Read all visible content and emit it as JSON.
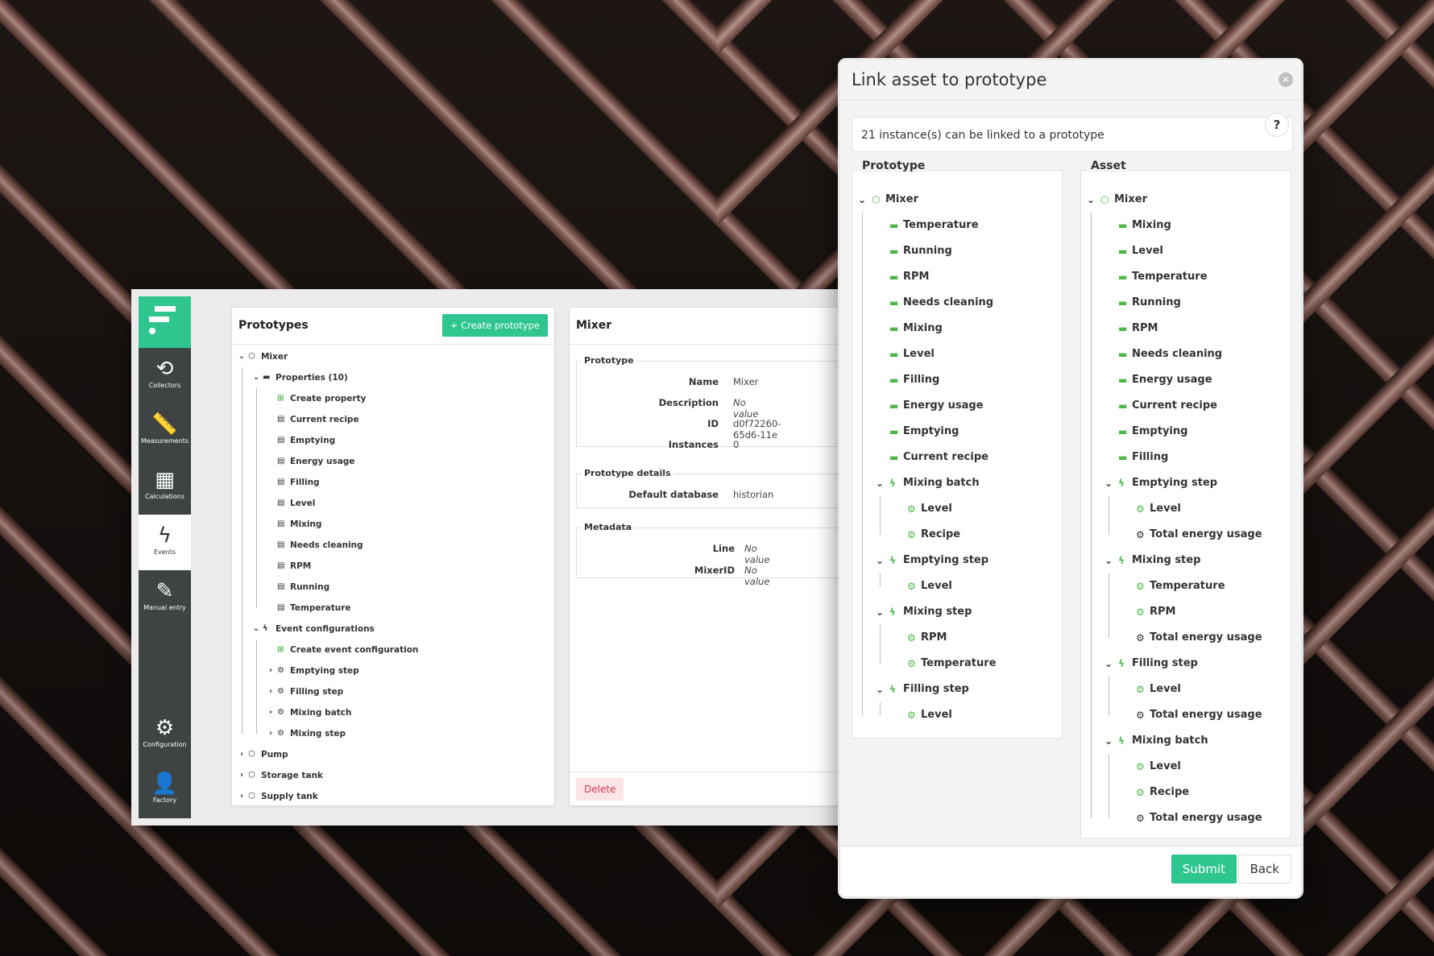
{
  "sidebar": {
    "items": [
      {
        "label": "Collectors",
        "icon": "history-icon"
      },
      {
        "label": "Measurements",
        "icon": "ruler-icon"
      },
      {
        "label": "Calculations",
        "icon": "calculator-icon"
      },
      {
        "label": "Events",
        "icon": "bolt-icon"
      },
      {
        "label": "Manual entry",
        "icon": "pencil-icon"
      }
    ],
    "bottom_items": [
      {
        "label": "Configuration",
        "icon": "gears-icon"
      },
      {
        "label": "Factory",
        "icon": "user-gear-icon"
      }
    ]
  },
  "prototypes": {
    "title": "Prototypes",
    "create_label": "Create prototype",
    "tree": [
      {
        "label": "Mixer",
        "lvl": 0,
        "caret": "down",
        "icon": "cube"
      },
      {
        "label": "Properties (10)",
        "lvl": 1,
        "caret": "down",
        "icon": "ruler"
      },
      {
        "label": "Create property",
        "lvl": 2,
        "icon": "plus"
      },
      {
        "label": "Current recipe",
        "lvl": 2,
        "icon": "table"
      },
      {
        "label": "Emptying",
        "lvl": 2,
        "icon": "table"
      },
      {
        "label": "Energy usage",
        "lvl": 2,
        "icon": "table"
      },
      {
        "label": "Filling",
        "lvl": 2,
        "icon": "table"
      },
      {
        "label": "Level",
        "lvl": 2,
        "icon": "table"
      },
      {
        "label": "Mixing",
        "lvl": 2,
        "icon": "table"
      },
      {
        "label": "Needs cleaning",
        "lvl": 2,
        "icon": "table"
      },
      {
        "label": "RPM",
        "lvl": 2,
        "icon": "table"
      },
      {
        "label": "Running",
        "lvl": 2,
        "icon": "table"
      },
      {
        "label": "Temperature",
        "lvl": 2,
        "icon": "table"
      },
      {
        "label": "Event configurations",
        "lvl": 1,
        "caret": "down",
        "icon": "bolt"
      },
      {
        "label": "Create event configuration",
        "lvl": 2,
        "icon": "plus"
      },
      {
        "label": "Emptying step",
        "lvl": 2,
        "caret": "right",
        "icon": "gears"
      },
      {
        "label": "Filling step",
        "lvl": 2,
        "caret": "right",
        "icon": "gears"
      },
      {
        "label": "Mixing batch",
        "lvl": 2,
        "caret": "right",
        "icon": "gears"
      },
      {
        "label": "Mixing step",
        "lvl": 2,
        "caret": "right",
        "icon": "gears"
      },
      {
        "label": "Pump",
        "lvl": 0,
        "caret": "right",
        "icon": "cube"
      },
      {
        "label": "Storage tank",
        "lvl": 0,
        "caret": "right",
        "icon": "cube"
      },
      {
        "label": "Supply tank",
        "lvl": 0,
        "caret": "right",
        "icon": "cube"
      }
    ]
  },
  "detail": {
    "title": "Mixer",
    "prototype_legend": "Prototype",
    "name_label": "Name",
    "name_value": "Mixer",
    "description_label": "Description",
    "description_value": "No value",
    "id_label": "ID",
    "id_value": "d0f72260-65d6-11e",
    "instances_label": "Instances",
    "instances_value": "0",
    "details_legend": "Prototype details",
    "default_db_label": "Default database",
    "default_db_value": "historian",
    "metadata_legend": "Metadata",
    "line_label": "Line",
    "line_value": "No value",
    "mixerid_label": "MixerID",
    "mixerid_value": "No value",
    "delete_label": "Delete"
  },
  "modal": {
    "title": "Link asset to prototype",
    "close_icon": "close-icon",
    "info": "21 instance(s) can be linked to a prototype",
    "help": "?",
    "prototype_title": "Prototype",
    "asset_title": "Asset",
    "prototype_tree": [
      {
        "label": "Mixer",
        "lvl": 0,
        "caret": "down",
        "icon": "cube"
      },
      {
        "label": "Temperature",
        "lvl": 1,
        "icon": "ruler"
      },
      {
        "label": "Running",
        "lvl": 1,
        "icon": "ruler"
      },
      {
        "label": "RPM",
        "lvl": 1,
        "icon": "ruler"
      },
      {
        "label": "Needs cleaning",
        "lvl": 1,
        "icon": "ruler"
      },
      {
        "label": "Mixing",
        "lvl": 1,
        "icon": "ruler"
      },
      {
        "label": "Level",
        "lvl": 1,
        "icon": "ruler"
      },
      {
        "label": "Filling",
        "lvl": 1,
        "icon": "ruler"
      },
      {
        "label": "Energy usage",
        "lvl": 1,
        "icon": "ruler"
      },
      {
        "label": "Emptying",
        "lvl": 1,
        "icon": "ruler"
      },
      {
        "label": "Current recipe",
        "lvl": 1,
        "icon": "ruler"
      },
      {
        "label": "Mixing batch",
        "lvl": 1,
        "caret": "down",
        "icon": "bolt"
      },
      {
        "label": "Level",
        "lvl": 2,
        "icon": "gears-g"
      },
      {
        "label": "Recipe",
        "lvl": 2,
        "icon": "gears-g"
      },
      {
        "label": "Emptying step",
        "lvl": 1,
        "caret": "down",
        "icon": "bolt"
      },
      {
        "label": "Level",
        "lvl": 2,
        "icon": "gears-g"
      },
      {
        "label": "Mixing step",
        "lvl": 1,
        "caret": "down",
        "icon": "bolt"
      },
      {
        "label": "RPM",
        "lvl": 2,
        "icon": "gears-g"
      },
      {
        "label": "Temperature",
        "lvl": 2,
        "icon": "gears-g"
      },
      {
        "label": "Filling step",
        "lvl": 1,
        "caret": "down",
        "icon": "bolt"
      },
      {
        "label": "Level",
        "lvl": 2,
        "icon": "gears-g"
      }
    ],
    "asset_tree": [
      {
        "label": "Mixer",
        "lvl": 0,
        "caret": "down",
        "icon": "cube"
      },
      {
        "label": "Mixing",
        "lvl": 1,
        "icon": "ruler"
      },
      {
        "label": "Level",
        "lvl": 1,
        "icon": "ruler"
      },
      {
        "label": "Temperature",
        "lvl": 1,
        "icon": "ruler"
      },
      {
        "label": "Running",
        "lvl": 1,
        "icon": "ruler"
      },
      {
        "label": "RPM",
        "lvl": 1,
        "icon": "ruler"
      },
      {
        "label": "Needs cleaning",
        "lvl": 1,
        "icon": "ruler"
      },
      {
        "label": "Energy usage",
        "lvl": 1,
        "icon": "ruler"
      },
      {
        "label": "Current recipe",
        "lvl": 1,
        "icon": "ruler"
      },
      {
        "label": "Emptying",
        "lvl": 1,
        "icon": "ruler"
      },
      {
        "label": "Filling",
        "lvl": 1,
        "icon": "ruler"
      },
      {
        "label": "Emptying step",
        "lvl": 1,
        "caret": "down",
        "icon": "bolt"
      },
      {
        "label": "Level",
        "lvl": 2,
        "icon": "gears-g"
      },
      {
        "label": "Total energy usage",
        "lvl": 2,
        "icon": "gears"
      },
      {
        "label": "Mixing step",
        "lvl": 1,
        "caret": "down",
        "icon": "bolt"
      },
      {
        "label": "Temperature",
        "lvl": 2,
        "icon": "gears-g"
      },
      {
        "label": "RPM",
        "lvl": 2,
        "icon": "gears-g"
      },
      {
        "label": "Total energy usage",
        "lvl": 2,
        "icon": "gears"
      },
      {
        "label": "Filling step",
        "lvl": 1,
        "caret": "down",
        "icon": "bolt"
      },
      {
        "label": "Level",
        "lvl": 2,
        "icon": "gears-g"
      },
      {
        "label": "Total energy usage",
        "lvl": 2,
        "icon": "gears"
      },
      {
        "label": "Mixing batch",
        "lvl": 1,
        "caret": "down",
        "icon": "bolt"
      },
      {
        "label": "Level",
        "lvl": 2,
        "icon": "gears-g"
      },
      {
        "label": "Recipe",
        "lvl": 2,
        "icon": "gears-g"
      },
      {
        "label": "Total energy usage",
        "lvl": 2,
        "icon": "gears"
      }
    ],
    "submit_label": "Submit",
    "back_label": "Back"
  },
  "colors": {
    "accent": "#2ec58f",
    "sidebar": "#3d4443",
    "danger": "#d43d4e",
    "icon_green": "#4db848"
  }
}
